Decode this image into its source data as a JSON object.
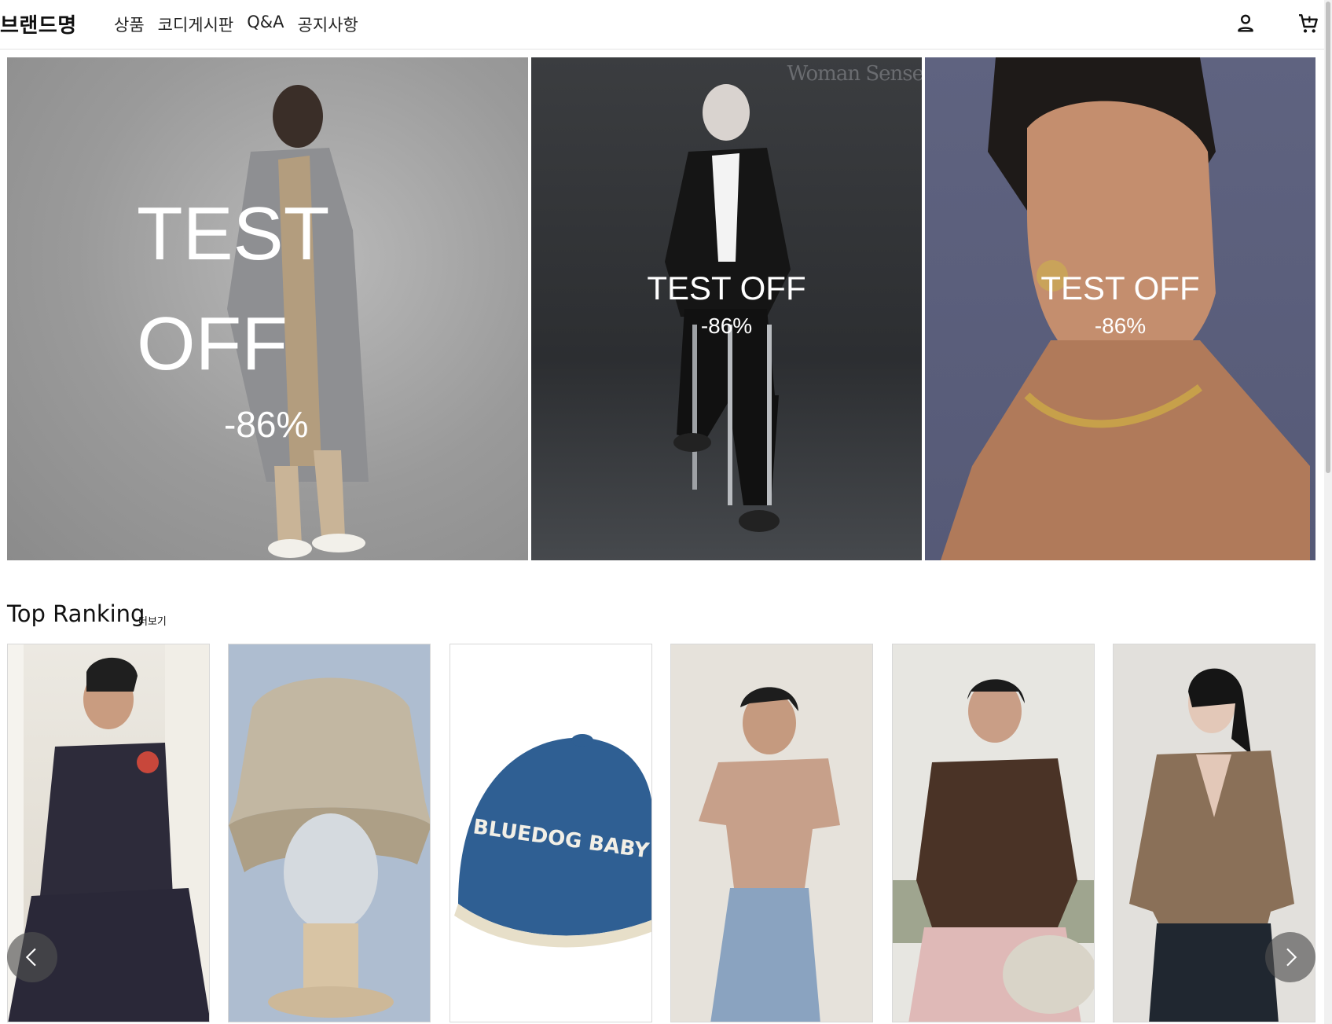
{
  "header": {
    "brand": "브랜드명",
    "nav": [
      "상품",
      "코디게시판",
      "Q&A",
      "공지사항"
    ],
    "icons": [
      "user-icon",
      "cart-icon",
      "search-icon"
    ]
  },
  "banners": [
    {
      "title_line1": "TEST",
      "title_line2": "OFF",
      "discount": "-86%"
    },
    {
      "title": "TEST OFF",
      "discount": "-86%",
      "watermark": "Woman Sense"
    },
    {
      "title": "TEST OFF",
      "discount": "-86%"
    }
  ],
  "ranking": {
    "title": "Top Ranking",
    "more": "더보기",
    "products": [
      {
        "image": "denim jacket and wide pants outfit"
      },
      {
        "image": "beige bucket hat on mannequin"
      },
      {
        "image": "navy baseball cap",
        "print": "BLUEDOG BABY"
      },
      {
        "image": "pink short-sleeve knit top"
      },
      {
        "image": "brown knit collar cardigan"
      },
      {
        "image": "brown v-neck cardigan"
      }
    ]
  },
  "controls": {
    "prev": "chevron-left-icon",
    "next": "chevron-right-icon"
  }
}
